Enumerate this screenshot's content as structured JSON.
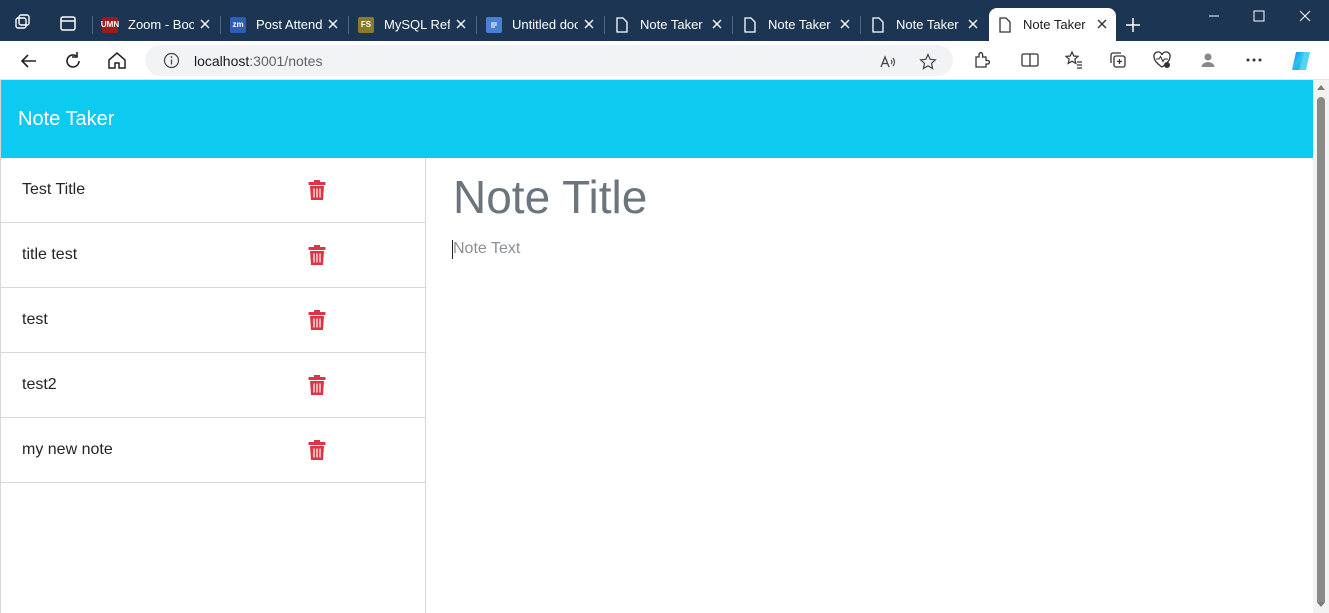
{
  "browser": {
    "tabs": [
      {
        "label": "Zoom - Boo",
        "favicon_text": "UMN",
        "favicon_color": "#9b1c1c",
        "active": false
      },
      {
        "label": "Post Attend",
        "favicon_text": "zm",
        "favicon_color": "#2b5fb3",
        "active": false
      },
      {
        "label": "MySQL Refe",
        "favicon_text": "FS",
        "favicon_color": "#8a7a2a",
        "active": false
      },
      {
        "label": "Untitled doc",
        "favicon_text": "",
        "favicon_color": "#4a7fd6",
        "active": false
      },
      {
        "label": "Note Taker",
        "favicon_text": "",
        "favicon_color": "",
        "active": false
      },
      {
        "label": "Note Taker",
        "favicon_text": "",
        "favicon_color": "",
        "active": false
      },
      {
        "label": "Note Taker",
        "favicon_text": "",
        "favicon_color": "",
        "active": false
      },
      {
        "label": "Note Taker",
        "favicon_text": "",
        "favicon_color": "",
        "active": true
      }
    ],
    "address": {
      "host": "localhost",
      "path": ":3001/notes"
    }
  },
  "app": {
    "brand": "Note Taker",
    "header_color": "#0dcaf0",
    "delete_color": "#dc3545",
    "notes": [
      {
        "title": "Test Title"
      },
      {
        "title": "title test"
      },
      {
        "title": "test"
      },
      {
        "title": "test2"
      },
      {
        "title": "my new note"
      }
    ],
    "editor": {
      "title_placeholder": "Note Title",
      "text_placeholder": "Note Text"
    }
  }
}
